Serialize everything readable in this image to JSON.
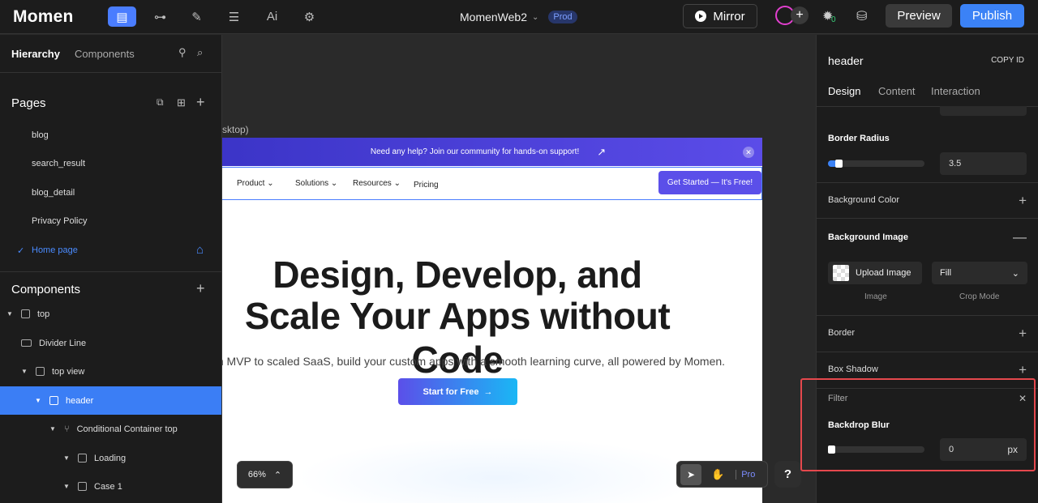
{
  "topbar": {
    "logo": "Momen",
    "project_name": "MomenWeb2",
    "env_tag": "Prod",
    "mirror_label": "Mirror",
    "bug_count": "0",
    "preview_label": "Preview",
    "publish_label": "Publish"
  },
  "left": {
    "tabs": [
      "Hierarchy",
      "Components"
    ],
    "pages_title": "Pages",
    "pages": [
      "blog",
      "search_result",
      "blog_detail",
      "Privacy Policy",
      "Home page"
    ],
    "components_title": "Components",
    "tree": [
      {
        "label": "top",
        "tri": "▼"
      },
      {
        "label": "Divider Line",
        "tri": ""
      },
      {
        "label": "top view",
        "tri": "▼"
      },
      {
        "label": "header",
        "tri": "▼"
      },
      {
        "label": "Conditional Container top",
        "tri": "▼"
      },
      {
        "label": "Loading",
        "tri": "▼"
      },
      {
        "label": "Case 1",
        "tri": "▼"
      }
    ]
  },
  "canvas": {
    "frame_label": "sktop)",
    "banner_text": "Need any help? Join our community for hands-on support!",
    "nav": [
      "Product",
      "Solutions",
      "Resources",
      "Pricing"
    ],
    "cta": "Get Started — It's Free!",
    "hero_line1": "Design, Develop, and",
    "hero_line2": "Scale Your Apps without Code",
    "hero_sub": "m MVP to scaled SaaS, build your custom apps with a smooth learning curve, all powered by Momen.",
    "start_button": "Start for Free",
    "zoom": "66%",
    "pro_label": "Pro",
    "help": "?"
  },
  "right": {
    "title": "header",
    "copy_id": "COPY ID",
    "tabs": [
      "Design",
      "Content",
      "Interaction"
    ],
    "border_radius_label": "Border Radius",
    "border_radius_value": "3.5",
    "border_radius_fraction": 0.1,
    "background_color_label": "Background Color",
    "background_image_label": "Background Image",
    "upload_label": "Upload Image",
    "crop_value": "Fill",
    "image_caption": "Image",
    "crop_caption": "Crop Mode",
    "border_label": "Border",
    "box_shadow_label": "Box Shadow",
    "filter_label": "Filter",
    "backdrop_blur_label": "Backdrop Blur",
    "backdrop_blur_value": "0",
    "backdrop_blur_unit": "px",
    "backdrop_blur_fraction": 0
  },
  "colors": {
    "accent": "#3b82f6",
    "highlight": "#e5484d"
  }
}
